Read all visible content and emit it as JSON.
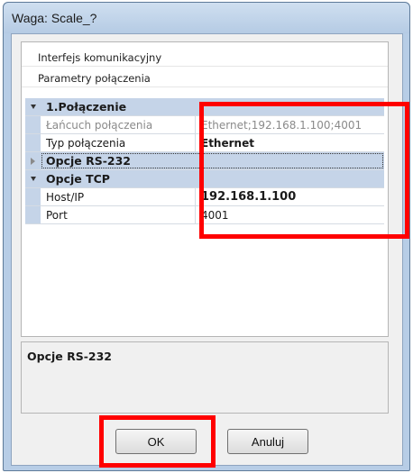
{
  "window": {
    "title": "Waga: Scale_?"
  },
  "panel": {
    "items": [
      {
        "label": "Interfejs komunikacyjny"
      },
      {
        "label": "Parametry połączenia"
      }
    ]
  },
  "grid": {
    "cat1": {
      "name": "1.Połączenie",
      "expanded": true
    },
    "row_chain": {
      "name": "Łańcuch połączenia",
      "value": "Ethernet;192.168.1.100;4001",
      "readonly": true
    },
    "row_type": {
      "name": "Typ połączenia",
      "value": "Ethernet"
    },
    "cat_rs232": {
      "name": "Opcje RS-232",
      "expanded": false
    },
    "cat_tcp": {
      "name": "Opcje TCP",
      "expanded": true
    },
    "row_host": {
      "name": "Host/IP",
      "value": "192.168.1.100"
    },
    "row_port": {
      "name": "Port",
      "value": "4001"
    }
  },
  "description": {
    "title": "Opcje RS-232"
  },
  "buttons": {
    "ok": "OK",
    "cancel": "Anuluj"
  },
  "highlight": {
    "color": "#ff0000"
  }
}
